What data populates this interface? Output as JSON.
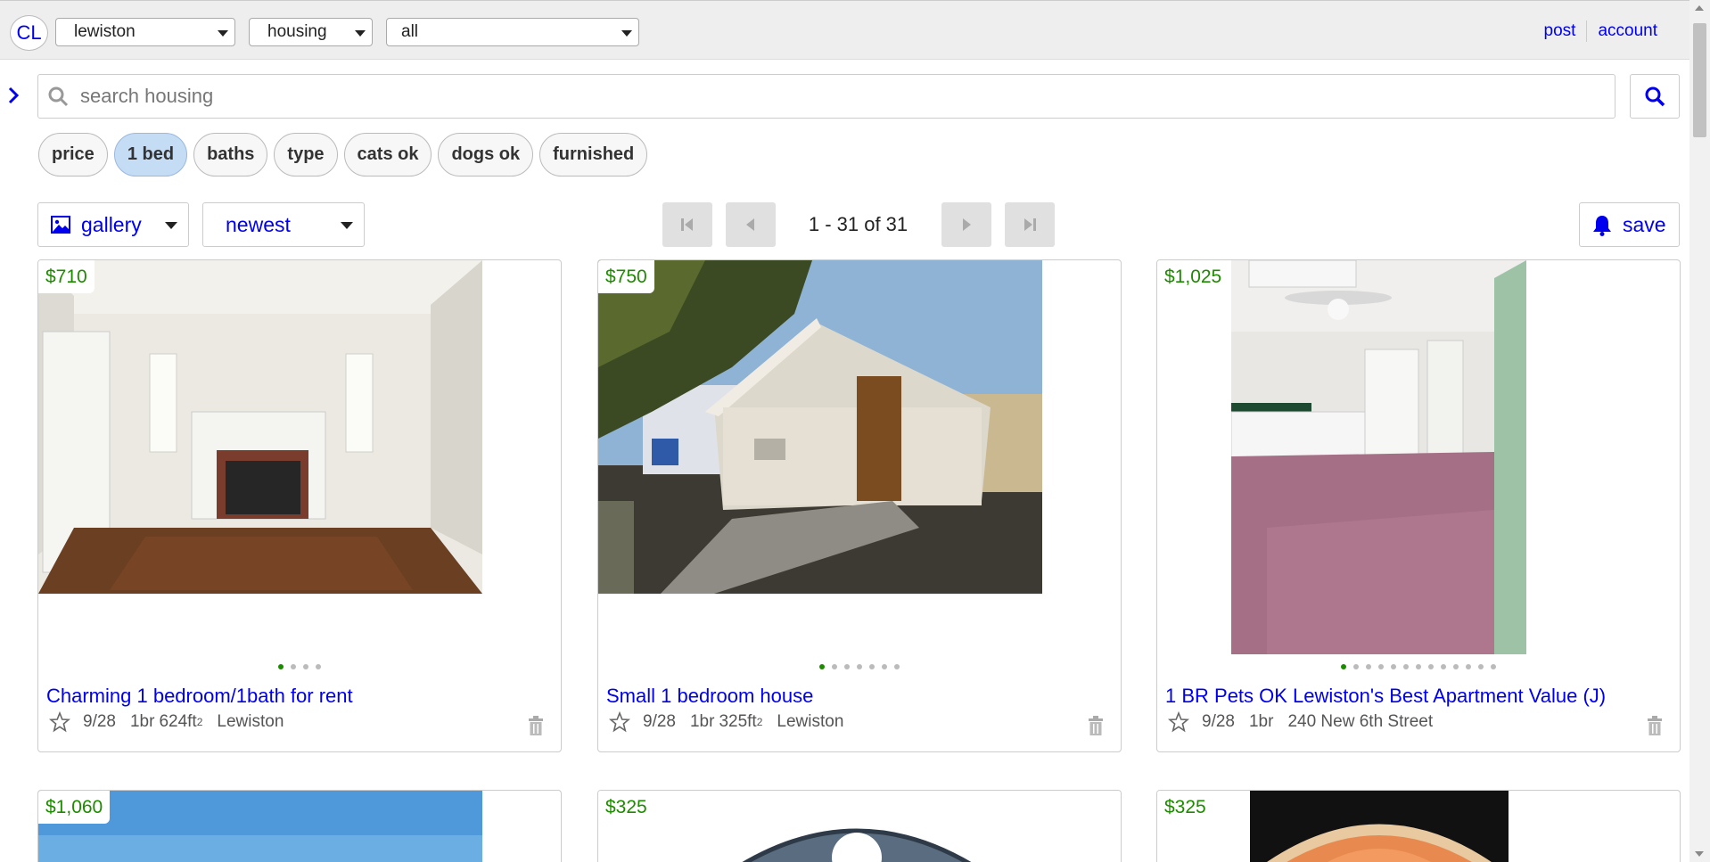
{
  "header": {
    "logo": "CL",
    "location": "lewiston",
    "category": "housing",
    "subcategory": "all",
    "links": [
      "post",
      "account"
    ]
  },
  "search": {
    "placeholder": "search housing",
    "value": ""
  },
  "filters": [
    {
      "label": "price",
      "active": false
    },
    {
      "label": "1 bed",
      "active": true
    },
    {
      "label": "baths",
      "active": false
    },
    {
      "label": "type",
      "active": false
    },
    {
      "label": "cats ok",
      "active": false
    },
    {
      "label": "dogs ok",
      "active": false
    },
    {
      "label": "furnished",
      "active": false
    }
  ],
  "toolbar": {
    "view": "gallery",
    "sort": "newest",
    "range": "1 - 31 of 31",
    "save_label": "save"
  },
  "listings": [
    {
      "price": "$710",
      "title": "Charming 1 bedroom/1bath for rent",
      "date": "9/28",
      "bedrooms": "1br",
      "size": "624ft",
      "size_unit": "2",
      "location": "Lewiston",
      "photo_count": 4,
      "photo_index": 0
    },
    {
      "price": "$750",
      "title": "Small 1 bedroom house",
      "date": "9/28",
      "bedrooms": "1br",
      "size": "325ft",
      "size_unit": "2",
      "location": "Lewiston",
      "photo_count": 7,
      "photo_index": 0
    },
    {
      "price": "$1,025",
      "title": "1 BR Pets OK Lewiston's Best Apartment Value (J)",
      "date": "9/28",
      "bedrooms": "1br",
      "size": "",
      "size_unit": "",
      "location": "240 New 6th Street",
      "photo_count": 13,
      "photo_index": 0
    },
    {
      "price": "$1,060"
    },
    {
      "price": "$325"
    },
    {
      "price": "$325"
    }
  ],
  "colors": {
    "link": "#0000ee",
    "price": "#1e8a00",
    "active_pill": "#c5dcf5"
  }
}
